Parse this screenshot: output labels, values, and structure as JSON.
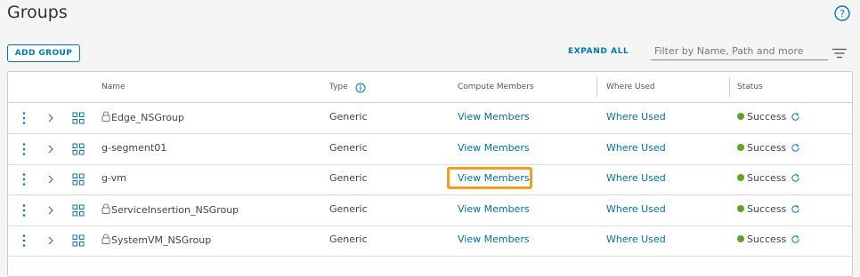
{
  "header": {
    "title": "Groups"
  },
  "toolbar": {
    "add_group_label": "ADD GROUP",
    "expand_all_label": "EXPAND ALL",
    "filter_placeholder": "Filter by Name, Path and more"
  },
  "table": {
    "columns": {
      "name": "Name",
      "type": "Type",
      "compute_members": "Compute Members",
      "where_used": "Where Used",
      "status": "Status"
    },
    "rows": [
      {
        "name": "Edge_NSGroup",
        "locked": true,
        "type": "Generic",
        "members": "View Members",
        "where_used": "Where Used",
        "status": "Success"
      },
      {
        "name": "g-segment01",
        "locked": false,
        "type": "Generic",
        "members": "View Members",
        "where_used": "Where Used",
        "status": "Success"
      },
      {
        "name": "g-vm",
        "locked": false,
        "type": "Generic",
        "members": "View Members",
        "where_used": "Where Used",
        "status": "Success",
        "members_highlighted": true
      },
      {
        "name": "ServiceInsertion_NSGroup",
        "locked": true,
        "type": "Generic",
        "members": "View Members",
        "where_used": "Where Used",
        "status": "Success"
      },
      {
        "name": "SystemVM_NSGroup",
        "locked": true,
        "type": "Generic",
        "members": "View Members",
        "where_used": "Where Used",
        "status": "Success"
      }
    ]
  },
  "colors": {
    "accent": "#0079b8",
    "link": "#0072a3",
    "success": "#62a420",
    "highlight": "#f49c1e"
  },
  "icons": [
    "help-icon",
    "filter-icon",
    "kebab-icon",
    "chevron-right-icon",
    "tree-icon",
    "lock-icon",
    "info-icon",
    "refresh-icon"
  ]
}
